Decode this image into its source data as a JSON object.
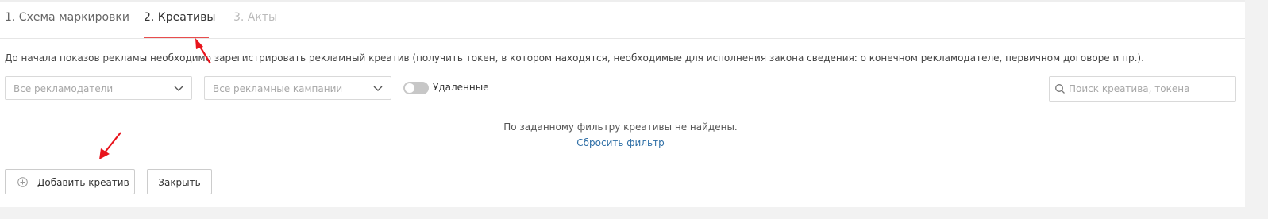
{
  "tabs": [
    {
      "label": "1. Схема маркировки",
      "active": false
    },
    {
      "label": "2. Креативы",
      "active": true
    },
    {
      "label": "3. Акты",
      "active": false
    }
  ],
  "info_text": "До начала показов рекламы необходимо зарегистрировать рекламный креатив (получить токен, в котором находятся, необходимые для исполнения закона сведения: о конечном рекламодателе, первичном договоре и пр.).",
  "filters": {
    "advertisers": {
      "value": "Все рекламодатели",
      "icon": "chevron-down-icon"
    },
    "campaigns": {
      "value": "Все рекламные кампании",
      "icon": "chevron-down-icon"
    },
    "deleted_toggle": {
      "label": "Удаленные",
      "on": false
    },
    "search": {
      "placeholder": "Поиск креатива, токена",
      "value": "",
      "icon": "search-icon"
    }
  },
  "empty_state": {
    "message": "По заданному фильтру креативы не найдены.",
    "reset_link": "Сбросить фильтр"
  },
  "actions": {
    "add_label": "Добавить креатив",
    "add_icon": "plus-circle-icon",
    "close_label": "Закрыть"
  },
  "colors": {
    "active_tab_underline": "#e84d4d",
    "link": "#2f6fa6",
    "annotation_arrow": "#e8141c"
  }
}
